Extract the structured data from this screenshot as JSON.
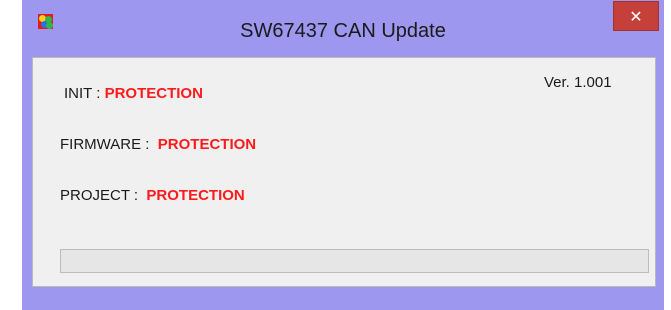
{
  "window": {
    "title": "SW67437 CAN Update",
    "close_glyph": "✕",
    "icon": "app-logo-icon"
  },
  "version": "Ver. 1.001",
  "status": {
    "init": {
      "label": "INIT : ",
      "value": "PROTECTION"
    },
    "firmware": {
      "label": "FIRMWARE : ",
      "value": "PROTECTION"
    },
    "project": {
      "label": "PROJECT : ",
      "value": "PROTECTION"
    }
  },
  "progress": {
    "percent": 0
  },
  "colors": {
    "titlebar": "#9d97f0",
    "close_button": "#c6403a",
    "status_value": "#ff1a1a",
    "progress_fill": "#06b025"
  }
}
